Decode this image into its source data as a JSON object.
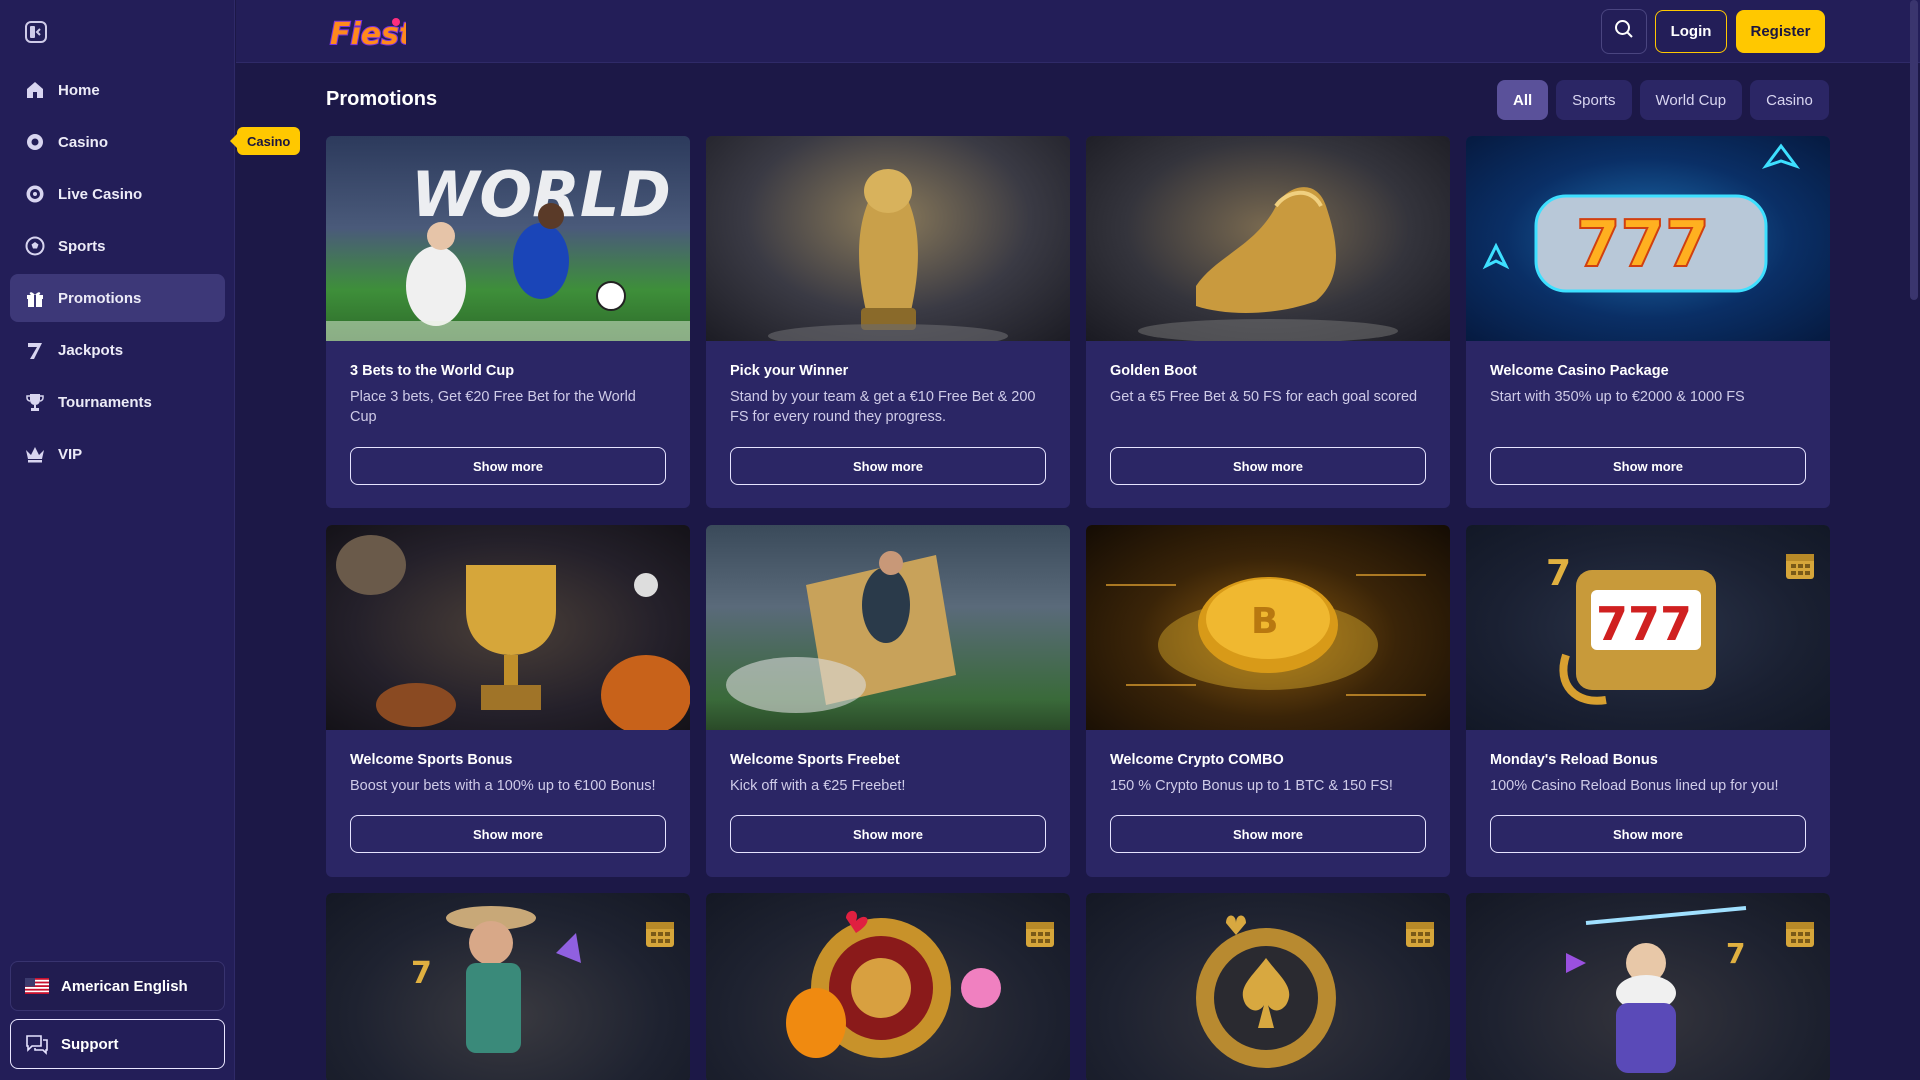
{
  "sidebar": {
    "items": [
      {
        "label": "Home",
        "icon": "home-icon"
      },
      {
        "label": "Casino",
        "icon": "casino-icon"
      },
      {
        "label": "Live Casino",
        "icon": "live-casino-icon"
      },
      {
        "label": "Sports",
        "icon": "soccer-ball-icon"
      },
      {
        "label": "Promotions",
        "icon": "gift-icon",
        "active": true
      },
      {
        "label": "Jackpots",
        "icon": "seven-icon"
      },
      {
        "label": "Tournaments",
        "icon": "trophy-icon"
      },
      {
        "label": "VIP",
        "icon": "crown-icon"
      }
    ],
    "language": "American English",
    "support": "Support",
    "tooltip": "Casino"
  },
  "header": {
    "logo_text": "Fiesta",
    "login": "Login",
    "register": "Register"
  },
  "main": {
    "title": "Promotions",
    "filters": [
      "All",
      "Sports",
      "World Cup",
      "Casino"
    ],
    "active_filter": "All",
    "cards": [
      {
        "title": "3 Bets to the World Cup",
        "desc": "Place 3 bets, Get €20 Free Bet for the World Cup",
        "button": "Show more",
        "image_text": "WORLD"
      },
      {
        "title": "Pick your Winner",
        "desc": "Stand by your team & get a €10 Free Bet & 200 FS for every round they progress.",
        "button": "Show more"
      },
      {
        "title": "Golden Boot",
        "desc": "Get a €5 Free Bet & 50 FS for each goal scored",
        "button": "Show more"
      },
      {
        "title": "Welcome Casino Package",
        "desc": "Start with 350% up to €2000 & 1000 FS",
        "button": "Show more",
        "image_text": "777"
      },
      {
        "title": "Welcome Sports Bonus",
        "desc": "Boost your bets with a 100% up to €100 Bonus!",
        "button": "Show more"
      },
      {
        "title": "Welcome Sports Freebet",
        "desc": "Kick off with a €25 Freebet!",
        "button": "Show more"
      },
      {
        "title": "Welcome Crypto COMBO",
        "desc": "150 % Crypto Bonus up to 1 BTC & 150 FS!",
        "button": "Show more"
      },
      {
        "title": "Monday's Reload Bonus",
        "desc": "100% Casino Reload Bonus lined up for you!",
        "button": "Show more",
        "image_text": "777"
      }
    ]
  },
  "colors": {
    "background": "#1c1847",
    "sidebar": "#231e58",
    "card": "#2b2665",
    "accent": "#ffc800",
    "active_nav": "#3d3878"
  }
}
